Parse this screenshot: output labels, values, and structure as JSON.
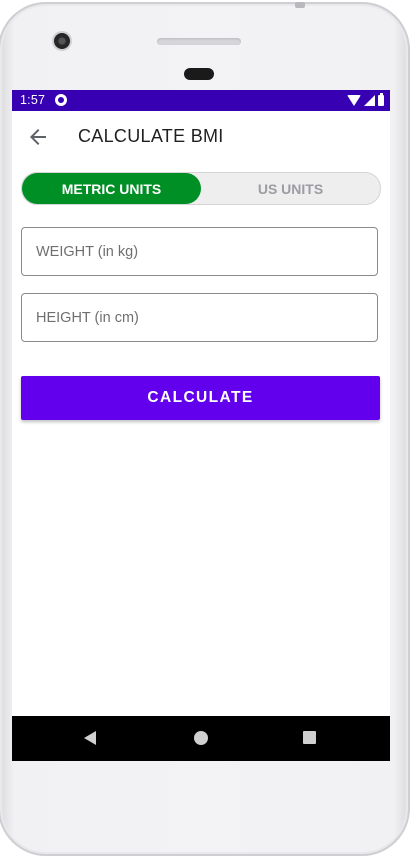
{
  "status_bar": {
    "time": "1:57",
    "app_icon": "app-notification-icon",
    "icons": [
      "wifi-icon",
      "signal-icon",
      "battery-icon"
    ],
    "color": "#3700b3"
  },
  "app_bar": {
    "back_icon": "arrow-left-icon",
    "title": "CALCULATE BMI"
  },
  "unit_toggle": {
    "metric_label": "METRIC UNITS",
    "us_label": "US UNITS",
    "selected": "METRIC UNITS",
    "active_color": "#008f24"
  },
  "form": {
    "weight_placeholder": "WEIGHT (in kg)",
    "weight_value": "",
    "height_placeholder": "HEIGHT (in cm)",
    "height_value": ""
  },
  "calculate": {
    "label": "CALCULATE",
    "color": "#6200ee"
  },
  "nav_bar": {
    "icons": [
      "nav-back-icon",
      "nav-home-icon",
      "nav-recents-icon"
    ]
  }
}
